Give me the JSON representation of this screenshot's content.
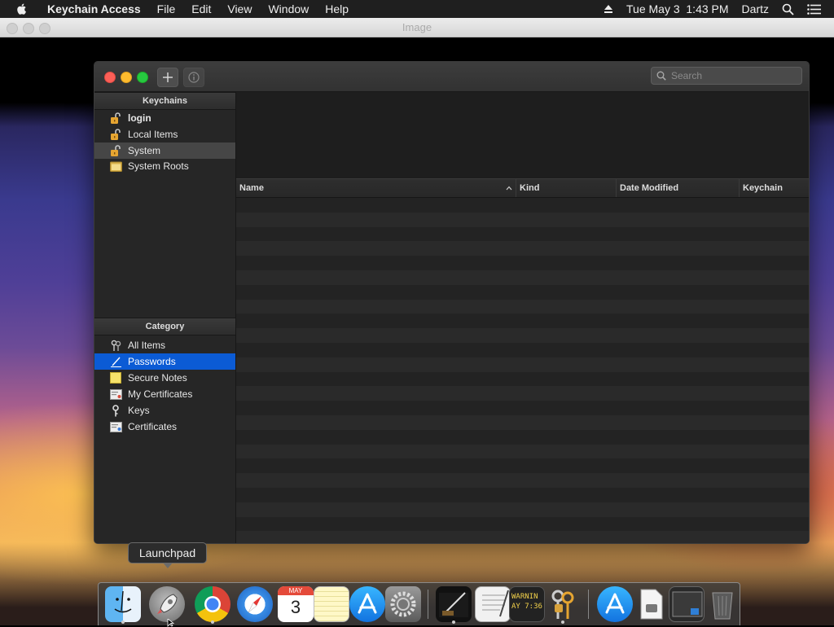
{
  "menubar": {
    "app_name": "Keychain Access",
    "menus": [
      "File",
      "Edit",
      "View",
      "Window",
      "Help"
    ],
    "datetime": "Tue May 3  1:43 PM",
    "user": "Dartz"
  },
  "outer_window": {
    "title": "Image"
  },
  "toolbar": {
    "search_placeholder": "Search"
  },
  "keychains": {
    "header": "Keychains",
    "items": [
      {
        "label": "login",
        "icon": "unlocked-padlock-icon",
        "bold": true
      },
      {
        "label": "Local Items",
        "icon": "unlocked-padlock-icon"
      },
      {
        "label": "System",
        "icon": "unlocked-padlock-icon",
        "selected": true
      },
      {
        "label": "System Roots",
        "icon": "folder-icon"
      }
    ]
  },
  "category": {
    "header": "Category",
    "items": [
      {
        "label": "All Items",
        "icon": "keys-icon"
      },
      {
        "label": "Passwords",
        "icon": "pen-icon",
        "selected": true
      },
      {
        "label": "Secure Notes",
        "icon": "note-icon"
      },
      {
        "label": "My Certificates",
        "icon": "certificate-icon"
      },
      {
        "label": "Keys",
        "icon": "key-icon"
      },
      {
        "label": "Certificates",
        "icon": "certificate-icon"
      }
    ]
  },
  "table": {
    "columns": [
      "Name",
      "Kind",
      "Date Modified",
      "Keychain"
    ],
    "sort_column": "Name",
    "rows": []
  },
  "tooltip": {
    "text": "Launchpad"
  },
  "dock": {
    "apps": [
      "Finder",
      "Launchpad",
      "Chrome",
      "Safari",
      "Calendar",
      "Notes",
      "App Store",
      "System Preferences",
      "Xcode",
      "TextEdit",
      "Console",
      "Keychain Access",
      "App Store",
      "Files",
      "Screenshot",
      "Trash"
    ],
    "calendar_month": "MAY",
    "calendar_day": "3",
    "console_text": [
      "WARNIN",
      "AY 7:36"
    ]
  },
  "colors": {
    "selection_blue": "#0b5bd5",
    "sidebar_bg": "#262626",
    "window_bg": "#1e1e1e"
  }
}
